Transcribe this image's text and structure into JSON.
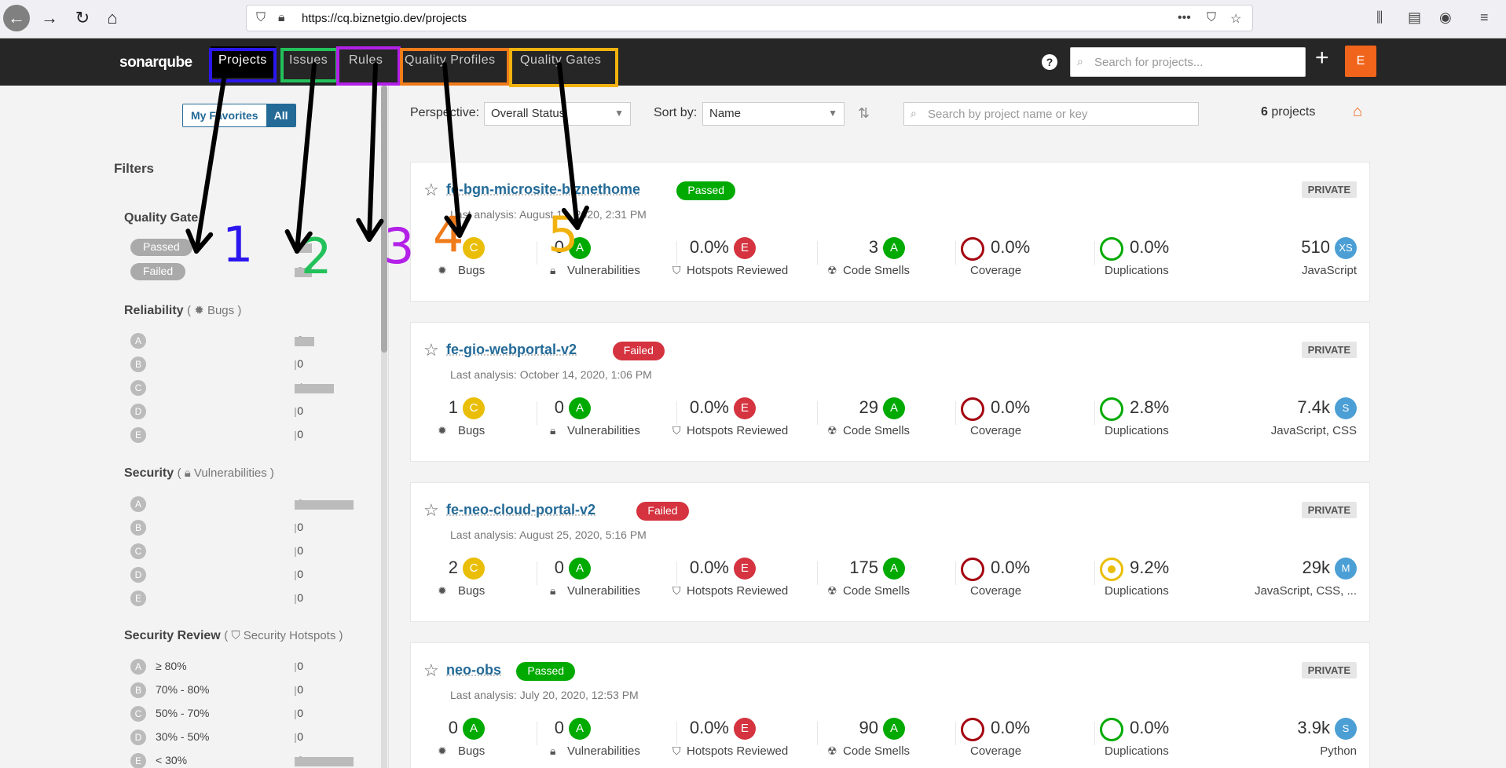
{
  "browser": {
    "url": "https://cq.biznetgio.dev/projects"
  },
  "nav": {
    "logo": "sonarqube",
    "items": [
      "Projects",
      "Issues",
      "Rules",
      "Quality Profiles",
      "Quality Gates"
    ],
    "search_placeholder": "Search for projects...",
    "plus": "+",
    "avatar": "E",
    "help": "?"
  },
  "annotation_colors": [
    "#2b16ee",
    "#23c15a",
    "#b320e8",
    "#f07b1b",
    "#f2b20e"
  ],
  "annotation_numbers": [
    "1",
    "2",
    "3",
    "4",
    "5"
  ],
  "sidebar": {
    "fav_my": "My Favorites",
    "fav_all": "All",
    "filters_title": "Filters",
    "quality_gate": {
      "title": "Quality Gate",
      "rows": [
        {
          "label": "Passed",
          "count": "3"
        },
        {
          "label": "Failed",
          "count": "3"
        }
      ]
    },
    "reliability": {
      "title": "Reliability",
      "sub": "Bugs",
      "rows": [
        {
          "r": "A",
          "count": "2"
        },
        {
          "r": "B",
          "count": "0"
        },
        {
          "r": "C",
          "count": "4"
        },
        {
          "r": "D",
          "count": "0"
        },
        {
          "r": "E",
          "count": "0"
        }
      ]
    },
    "security": {
      "title": "Security",
      "sub": "Vulnerabilities",
      "rows": [
        {
          "r": "A",
          "count": "6"
        },
        {
          "r": "B",
          "count": "0"
        },
        {
          "r": "C",
          "count": "0"
        },
        {
          "r": "D",
          "count": "0"
        },
        {
          "r": "E",
          "count": "0"
        }
      ]
    },
    "security_review": {
      "title": "Security Review",
      "sub": "Security Hotspots",
      "rows": [
        {
          "r": "A",
          "label": "≥ 80%",
          "count": "0"
        },
        {
          "r": "B",
          "label": "70% - 80%",
          "count": "0"
        },
        {
          "r": "C",
          "label": "50% - 70%",
          "count": "0"
        },
        {
          "r": "D",
          "label": "30% - 50%",
          "count": "0"
        },
        {
          "r": "E",
          "label": "< 30%",
          "count": "6"
        }
      ]
    }
  },
  "toolbar": {
    "perspective_label": "Perspective:",
    "perspective_value": "Overall Status",
    "sort_label": "Sort by:",
    "sort_value": "Name",
    "search_placeholder": "Search by project name or key",
    "count_num": "6",
    "count_text": " projects"
  },
  "labels": {
    "bugs": "Bugs",
    "vulns": "Vulnerabilities",
    "hotspots": "Hotspots Reviewed",
    "smells": "Code Smells",
    "coverage": "Coverage",
    "dup": "Duplications",
    "private": "PRIVATE"
  },
  "projects": [
    {
      "name": "fe-bgn-microsite-biznethome",
      "gate": "Passed",
      "analysis": "Last analysis: August 13, 2020, 2:31 PM",
      "bugs": "",
      "bugs_r": "C",
      "vulns": "0",
      "vulns_r": "A",
      "hotspots": "0.0%",
      "hotspots_r": "E",
      "smells": "3",
      "smells_r": "A",
      "coverage": "0.0%",
      "dup": "0.0%",
      "dup_state": "green",
      "size": "510",
      "size_r": "XS",
      "lang": "JavaScript"
    },
    {
      "name": "fe-gio-webportal-v2",
      "gate": "Failed",
      "analysis": "Last analysis: October 14, 2020, 1:06 PM",
      "bugs": "1",
      "bugs_r": "C",
      "vulns": "0",
      "vulns_r": "A",
      "hotspots": "0.0%",
      "hotspots_r": "E",
      "smells": "29",
      "smells_r": "A",
      "coverage": "0.0%",
      "dup": "2.8%",
      "dup_state": "green",
      "size": "7.4k",
      "size_r": "S",
      "lang": "JavaScript, CSS"
    },
    {
      "name": "fe-neo-cloud-portal-v2",
      "gate": "Failed",
      "analysis": "Last analysis: August 25, 2020, 5:16 PM",
      "bugs": "2",
      "bugs_r": "C",
      "vulns": "0",
      "vulns_r": "A",
      "hotspots": "0.0%",
      "hotspots_r": "E",
      "smells": "175",
      "smells_r": "A",
      "coverage": "0.0%",
      "dup": "9.2%",
      "dup_state": "yellow",
      "size": "29k",
      "size_r": "M",
      "lang": "JavaScript, CSS, ..."
    },
    {
      "name": "neo-obs",
      "gate": "Passed",
      "analysis": "Last analysis: July 20, 2020, 12:53 PM",
      "bugs": "0",
      "bugs_r": "A",
      "vulns": "0",
      "vulns_r": "A",
      "hotspots": "0.0%",
      "hotspots_r": "E",
      "smells": "90",
      "smells_r": "A",
      "coverage": "0.0%",
      "dup": "0.0%",
      "dup_state": "green",
      "size": "3.9k",
      "size_r": "S",
      "lang": "Python"
    }
  ]
}
